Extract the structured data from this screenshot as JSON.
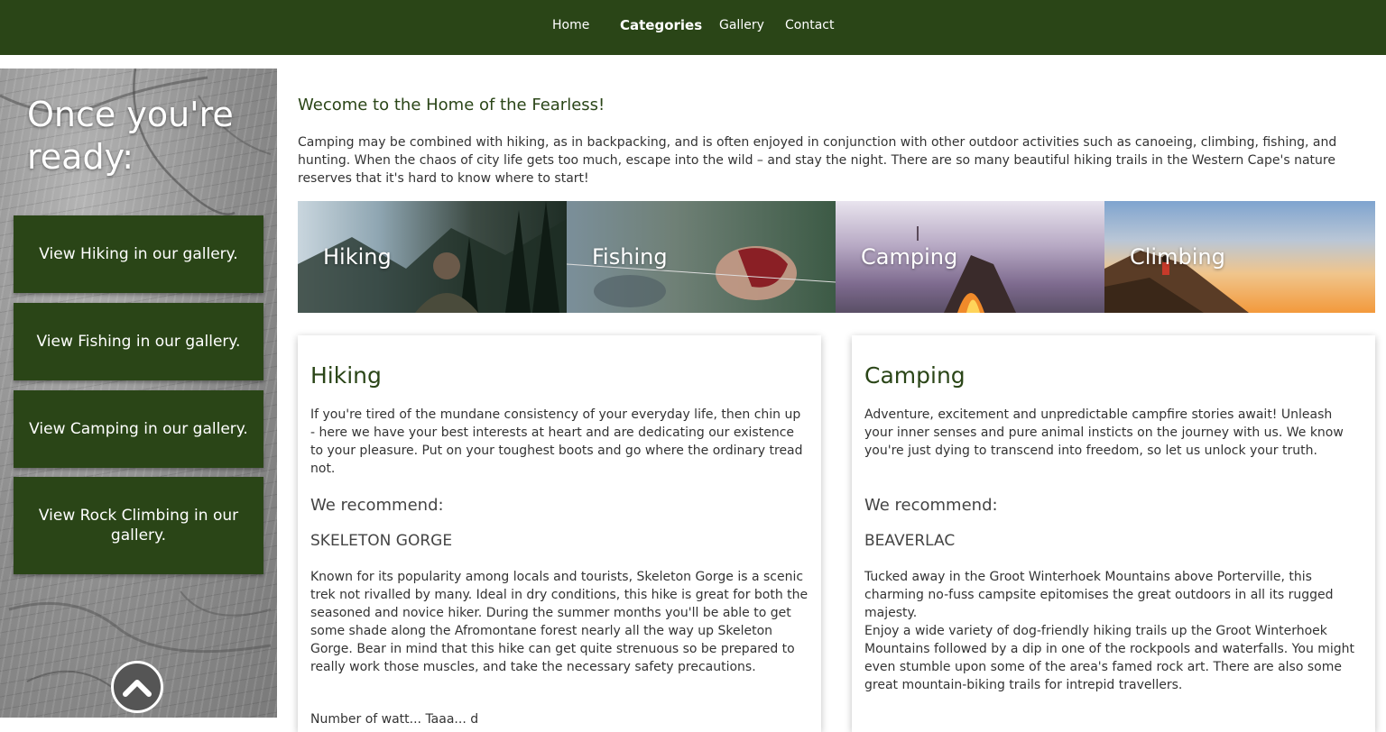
{
  "nav": {
    "items": [
      {
        "label": "Home"
      },
      {
        "label": "Categories"
      },
      {
        "label": "Gallery"
      },
      {
        "label": "Contact"
      }
    ],
    "active": "Categories"
  },
  "sidebar": {
    "heading": "Once you're ready:",
    "buttons": [
      {
        "label": "View Hiking in our gallery."
      },
      {
        "label": "View Fishing in our gallery."
      },
      {
        "label": "View Camping in our gallery."
      },
      {
        "label": "View Rock Climbing in our gallery."
      }
    ],
    "scroll_top_icon": "chevron-up-icon"
  },
  "main": {
    "welcome": "Wecome to the Home of the Fearless!",
    "intro": "Camping may be combined with hiking, as in backpacking, and is often enjoyed in conjunction with other outdoor activities such as canoeing, climbing, fishing, and hunting. When the chaos of city life gets too much, escape into the wild – and stay the night. There are so many beautiful hiking trails in the Western Cape's nature reserves that it's hard to know where to start!",
    "categories": [
      {
        "label": "Hiking"
      },
      {
        "label": "Fishing"
      },
      {
        "label": "Camping"
      },
      {
        "label": "Climbing"
      }
    ],
    "cards": [
      {
        "title": "Hiking",
        "description": "If you're tired of the mundane consistency of your everyday life, then chin up - here we have your best interests at heart and are dedicating our existence to your pleasure. Put on your toughest boots and go where the ordinary tread not.",
        "recommend": "We recommend:",
        "place": "SKELETON GORGE",
        "details": "Known for its popularity among locals and tourists, Skeleton Gorge is a scenic trek not rivalled by many. Ideal in dry conditions, this hike is great for both the seasoned and novice hiker. During the summer months you'll be able to get some shade along the Afromontane forest nearly all the way up Skeleton Gorge. Bear in mind that this hike can get quite strenuous so be prepared to really work those muscles, and take the necessary safety precautions.",
        "extra": "Number of watt... Taaa... d"
      },
      {
        "title": "Camping",
        "description": "Adventure, excitement and unpredictable campfire stories await! Unleash your inner senses and pure animal insticts on the journey with us. We know you're just dying to transcend into freedom, so let us unlock your truth.",
        "recommend": "We recommend:",
        "place": "BEAVERLAC",
        "details": "Tucked away in the Groot Winterhoek Mountains above Porterville, this charming no-fuss campsite epitomises the great outdoors in all its rugged majesty.\nEnjoy a wide variety of dog-friendly hiking trails up the Groot Winterhoek Mountains followed by a dip in one of the rockpools and waterfalls. You might even stumble upon some of the area's famed rock art. There are also some great mountain-biking trails for intrepid travellers.",
        "extra": ""
      }
    ]
  },
  "colors": {
    "brand_green": "#2a4517",
    "text": "#333333"
  }
}
